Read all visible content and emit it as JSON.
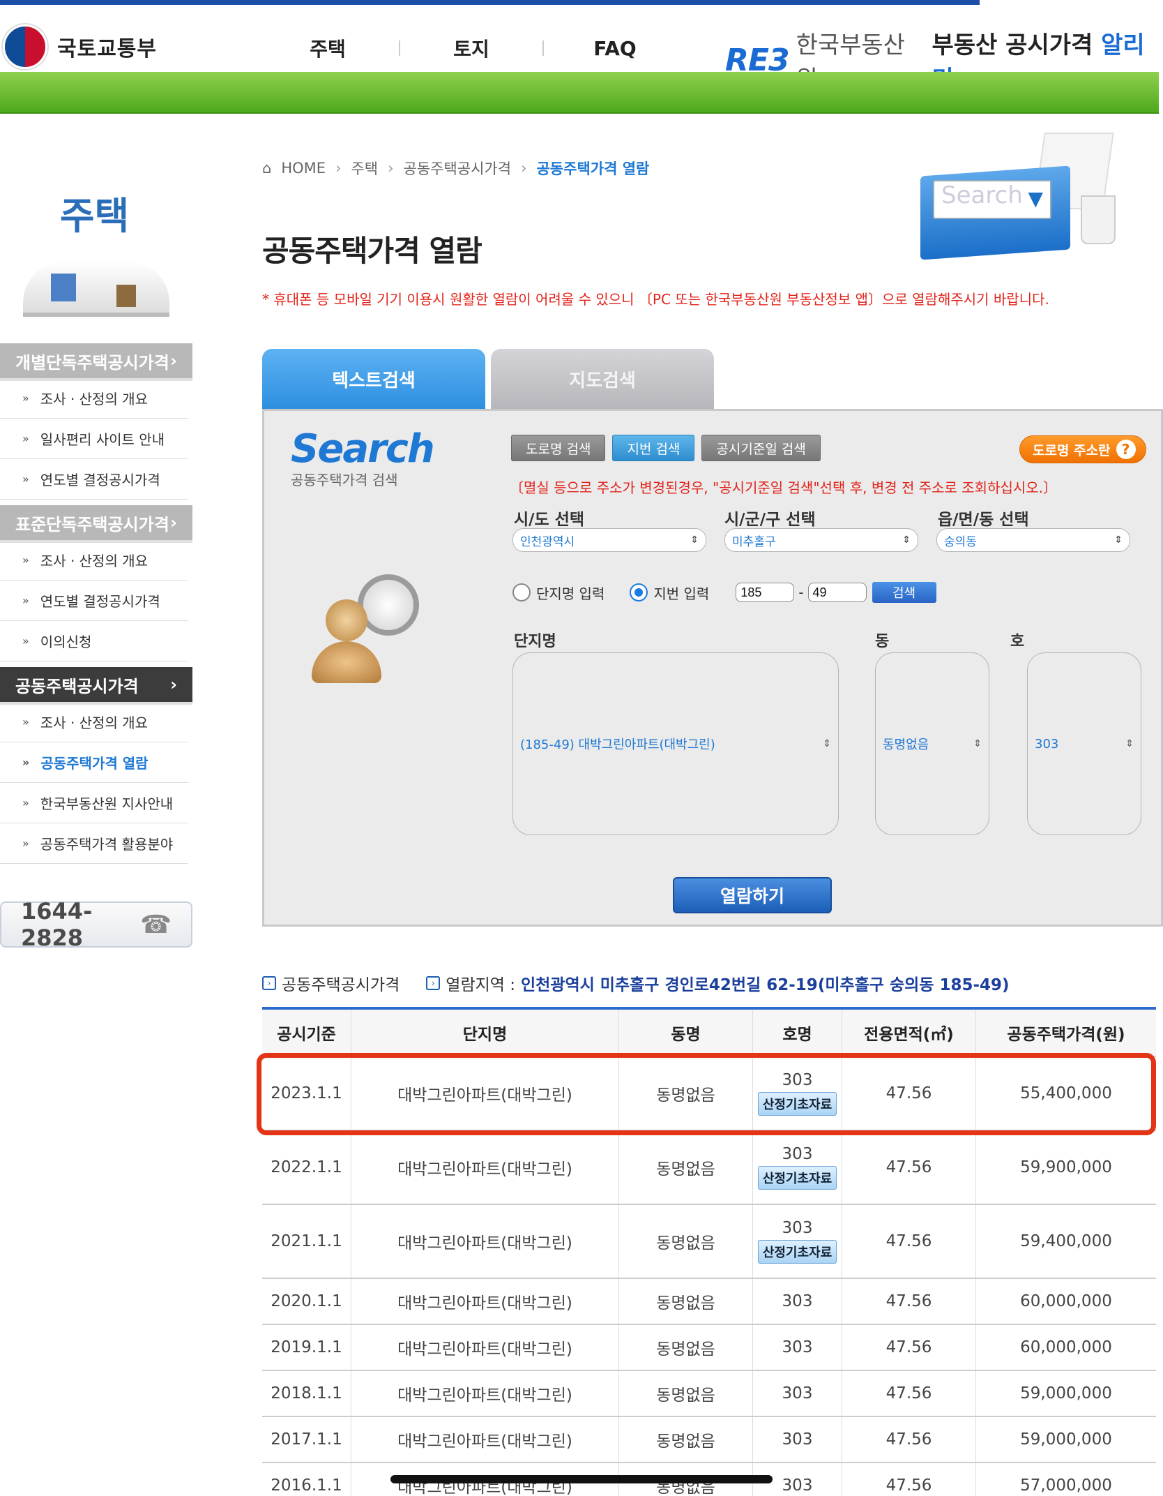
{
  "header": {
    "ministry": "국토교통부",
    "nav": [
      "주택",
      "토지",
      "FAQ"
    ],
    "reb_logo": "RE3",
    "reb_name": "한국부동산원",
    "service_prefix": "부동산 공시가격",
    "service_suffix": "알리미"
  },
  "sidebar": {
    "title": "주택",
    "groups": [
      {
        "label": "개별단독주택공시가격",
        "arrow": "›",
        "items": [
          "조사 · 산정의 개요",
          "일사편리 사이트 안내",
          "연도별 결정공시가격"
        ]
      },
      {
        "label": "표준단독주택공시가격",
        "arrow": "›",
        "items": [
          "조사 · 산정의 개요",
          "연도별 결정공시가격",
          "이의신청"
        ]
      },
      {
        "label": "공동주택공시가격",
        "arrow": "›",
        "items": [
          "조사 · 산정의 개요",
          "공동주택가격 열람",
          "한국부동산원 지사안내",
          "공동주택가격 활용분야"
        ]
      }
    ],
    "phone": "1644-2828"
  },
  "breadcrumb": {
    "home": "HOME",
    "items": [
      "주택",
      "공동주택공시가격"
    ],
    "current": "공동주택가격 열람",
    "sep": "›"
  },
  "hero_search_word": "Search",
  "page_title": "공동주택가격 열람",
  "notice": "* 휴대폰 등 모바일 기기 이용시 원활한 열람이 어려울 수 있으니 〔PC 또는 한국부동산원 부동산정보 앱〕으로 열람해주시기 바랍니다.",
  "tabs": {
    "text": "텍스트검색",
    "map": "지도검색"
  },
  "search": {
    "logo": "Search",
    "logo_sub": "공동주택가격 검색",
    "modes": [
      "도로명 검색",
      "지번 검색",
      "공시기준일 검색"
    ],
    "road_help": "도로명 주소란",
    "road_help_icon": "?",
    "warning": "〔멸실 등으로 주소가 변경된경우, \"공시기준일 검색\"선택 후, 변경 전 주소로 조회하십시오.〕",
    "sido_label": "시/도 선택",
    "sido_value": "인천광역시",
    "sigungu_label": "시/군/구 선택",
    "sigungu_value": "미추홀구",
    "dong_label": "읍/면/동 선택",
    "dong_value": "숭의동",
    "radio_complex": "단지명 입력",
    "radio_jibun": "지번 입력",
    "bunji_main": "185",
    "bunji_dash": "-",
    "bunji_sub": "49",
    "go": "검색",
    "complex_label": "단지명",
    "complex_value": "(185-49) 대박그린아파트(대박그린)",
    "building_label": "동",
    "building_value": "동명없음",
    "unit_label": "호",
    "unit_value": "303",
    "view_button": "열람하기"
  },
  "result": {
    "section_label": "공동주택공시가격",
    "region_label": "열람지역 :",
    "region_value": "인천광역시 미추홀구 경인로42번길 62-19(미추홀구 숭의동 185-49)",
    "columns": [
      "공시기준",
      "단지명",
      "동명",
      "호명",
      "전용면적(㎡)",
      "공동주택가격(원)"
    ],
    "doc_button": "산정기초자료",
    "rows": [
      {
        "date": "2023.1.1",
        "complex": "대박그린아파트(대박그린)",
        "dong": "동명없음",
        "ho": "303",
        "area": "47.56",
        "price": "55,400,000",
        "doc": true
      },
      {
        "date": "2022.1.1",
        "complex": "대박그린아파트(대박그린)",
        "dong": "동명없음",
        "ho": "303",
        "area": "47.56",
        "price": "59,900,000",
        "doc": true
      },
      {
        "date": "2021.1.1",
        "complex": "대박그린아파트(대박그린)",
        "dong": "동명없음",
        "ho": "303",
        "area": "47.56",
        "price": "59,400,000",
        "doc": true
      },
      {
        "date": "2020.1.1",
        "complex": "대박그린아파트(대박그린)",
        "dong": "동명없음",
        "ho": "303",
        "area": "47.56",
        "price": "60,000,000",
        "doc": false
      },
      {
        "date": "2019.1.1",
        "complex": "대박그린아파트(대박그린)",
        "dong": "동명없음",
        "ho": "303",
        "area": "47.56",
        "price": "60,000,000",
        "doc": false
      },
      {
        "date": "2018.1.1",
        "complex": "대박그린아파트(대박그린)",
        "dong": "동명없음",
        "ho": "303",
        "area": "47.56",
        "price": "59,000,000",
        "doc": false
      },
      {
        "date": "2017.1.1",
        "complex": "대박그린아파트(대박그린)",
        "dong": "동명없음",
        "ho": "303",
        "area": "47.56",
        "price": "59,000,000",
        "doc": false
      },
      {
        "date": "2016.1.1",
        "complex": "대박그린아파트(대박그린)",
        "dong": "동명없음",
        "ho": "303",
        "area": "47.56",
        "price": "57,000,000",
        "doc": false
      }
    ]
  },
  "colors": {
    "accent": "#1e78d4",
    "green_bar": "#5cb82a",
    "highlight": "#e33415",
    "warning": "#e2231a"
  }
}
